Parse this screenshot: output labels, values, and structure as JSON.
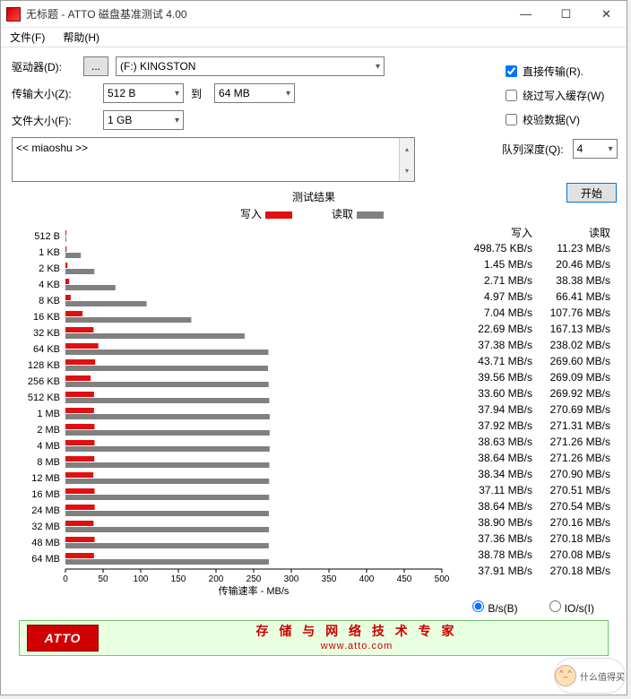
{
  "window": {
    "title": "无标题 - ATTO 磁盘基准测试 4.00",
    "minimize": "—",
    "maximize": "☐",
    "close": "✕"
  },
  "menu": {
    "file": "文件(F)",
    "help": "帮助(H)"
  },
  "form": {
    "drive_label": "驱动器(D):",
    "drive_value": "(F:) KINGSTON",
    "ellipsis": "...",
    "xfer_label": "传输大小(Z):",
    "xfer_from": "512 B",
    "to": "到",
    "xfer_to": "64 MB",
    "file_label": "文件大小(F):",
    "file_size": "1 GB"
  },
  "options": {
    "direct_io": "直接传输(R).",
    "direct_io_checked": true,
    "bypass_cache": "绕过写入缓存(W)",
    "bypass_cache_checked": false,
    "verify": "校验数据(V)",
    "verify_checked": false,
    "queue_depth_label": "队列深度(Q):",
    "queue_depth": "4"
  },
  "description_box": "<< miaoshu >>",
  "start_button": "开始",
  "results": {
    "title": "测试结果",
    "legend_write": "写入",
    "legend_read": "读取",
    "axis_label": "传输速率 - MB/s",
    "col_write": "写入",
    "col_read": "读取",
    "radio_bytes": "B/s(B)",
    "radio_io": "IO/s(I)",
    "radio_selected": "bytes"
  },
  "chart_data": {
    "type": "bar",
    "xlabel": "传输速率 - MB/s",
    "xlim": [
      0,
      500
    ],
    "xticks": [
      0,
      50,
      100,
      150,
      200,
      250,
      300,
      350,
      400,
      450,
      500
    ],
    "series": [
      {
        "name": "写入",
        "color": "#e01010"
      },
      {
        "name": "读取",
        "color": "#808080"
      }
    ],
    "rows": [
      {
        "label": "512 B",
        "write_mb": 0.49,
        "read_mb": 0.01,
        "write_txt": "498.75 KB/s",
        "read_txt": "11.23 MB/s"
      },
      {
        "label": "1 KB",
        "write_mb": 1.45,
        "read_mb": 20.46,
        "write_txt": "1.45 MB/s",
        "read_txt": "20.46 MB/s"
      },
      {
        "label": "2 KB",
        "write_mb": 2.71,
        "read_mb": 38.38,
        "write_txt": "2.71 MB/s",
        "read_txt": "38.38 MB/s"
      },
      {
        "label": "4 KB",
        "write_mb": 4.97,
        "read_mb": 66.41,
        "write_txt": "4.97 MB/s",
        "read_txt": "66.41 MB/s"
      },
      {
        "label": "8 KB",
        "write_mb": 7.04,
        "read_mb": 107.76,
        "write_txt": "7.04 MB/s",
        "read_txt": "107.76 MB/s"
      },
      {
        "label": "16 KB",
        "write_mb": 22.69,
        "read_mb": 167.13,
        "write_txt": "22.69 MB/s",
        "read_txt": "167.13 MB/s"
      },
      {
        "label": "32 KB",
        "write_mb": 37.38,
        "read_mb": 238.02,
        "write_txt": "37.38 MB/s",
        "read_txt": "238.02 MB/s"
      },
      {
        "label": "64 KB",
        "write_mb": 43.71,
        "read_mb": 269.6,
        "write_txt": "43.71 MB/s",
        "read_txt": "269.60 MB/s"
      },
      {
        "label": "128 KB",
        "write_mb": 39.56,
        "read_mb": 269.09,
        "write_txt": "39.56 MB/s",
        "read_txt": "269.09 MB/s"
      },
      {
        "label": "256 KB",
        "write_mb": 33.6,
        "read_mb": 269.92,
        "write_txt": "33.60 MB/s",
        "read_txt": "269.92 MB/s"
      },
      {
        "label": "512 KB",
        "write_mb": 37.94,
        "read_mb": 270.69,
        "write_txt": "37.94 MB/s",
        "read_txt": "270.69 MB/s"
      },
      {
        "label": "1 MB",
        "write_mb": 37.92,
        "read_mb": 271.31,
        "write_txt": "37.92 MB/s",
        "read_txt": "271.31 MB/s"
      },
      {
        "label": "2 MB",
        "write_mb": 38.63,
        "read_mb": 271.26,
        "write_txt": "38.63 MB/s",
        "read_txt": "271.26 MB/s"
      },
      {
        "label": "4 MB",
        "write_mb": 38.64,
        "read_mb": 271.26,
        "write_txt": "38.64 MB/s",
        "read_txt": "271.26 MB/s"
      },
      {
        "label": "8 MB",
        "write_mb": 38.34,
        "read_mb": 270.9,
        "write_txt": "38.34 MB/s",
        "read_txt": "270.90 MB/s"
      },
      {
        "label": "12 MB",
        "write_mb": 37.11,
        "read_mb": 270.51,
        "write_txt": "37.11 MB/s",
        "read_txt": "270.51 MB/s"
      },
      {
        "label": "16 MB",
        "write_mb": 38.64,
        "read_mb": 270.54,
        "write_txt": "38.64 MB/s",
        "read_txt": "270.54 MB/s"
      },
      {
        "label": "24 MB",
        "write_mb": 38.9,
        "read_mb": 270.16,
        "write_txt": "38.90 MB/s",
        "read_txt": "270.16 MB/s"
      },
      {
        "label": "32 MB",
        "write_mb": 37.36,
        "read_mb": 270.18,
        "write_txt": "37.36 MB/s",
        "read_txt": "270.18 MB/s"
      },
      {
        "label": "48 MB",
        "write_mb": 38.78,
        "read_mb": 270.08,
        "write_txt": "38.78 MB/s",
        "read_txt": "270.08 MB/s"
      },
      {
        "label": "64 MB",
        "write_mb": 37.91,
        "read_mb": 270.18,
        "write_txt": "37.91 MB/s",
        "read_txt": "270.18 MB/s"
      }
    ]
  },
  "banner": {
    "logo": "ATTO",
    "text": "存 储 与 网 络 技 术 专 家",
    "url": "www.atto.com"
  },
  "watermark": "什么值得买"
}
